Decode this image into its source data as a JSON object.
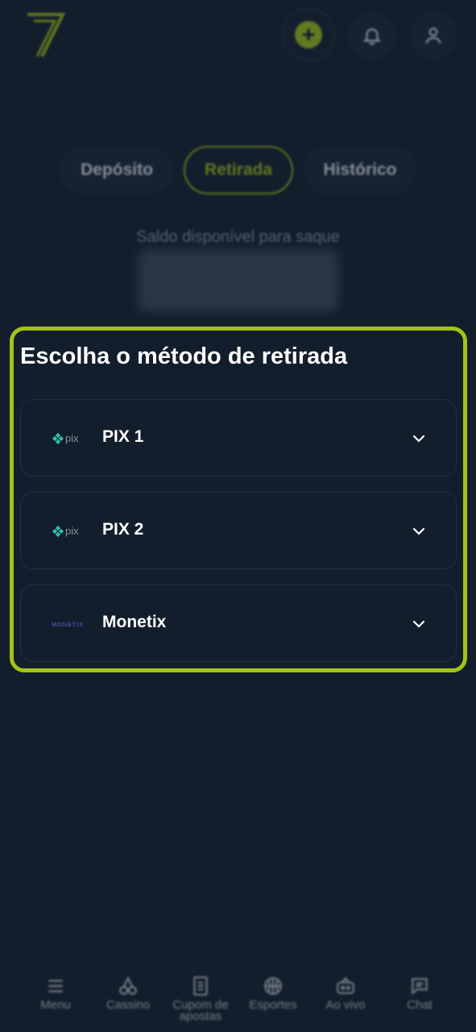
{
  "header": {
    "logo_icon": "seven-logo-icon",
    "deposit_icon": "plus-icon",
    "bell_icon": "bell-icon",
    "user_icon": "user-icon"
  },
  "tabs": [
    {
      "label": "Depósito",
      "active": false
    },
    {
      "label": "Retirada",
      "active": true
    },
    {
      "label": "Histórico",
      "active": false
    }
  ],
  "balance": {
    "label": "Saldo disponível para saque"
  },
  "withdraw": {
    "title": "Escolha o método de retirada",
    "methods": [
      {
        "label": "PIX 1",
        "logo_text": "pix"
      },
      {
        "label": "PIX 2",
        "logo_text": "pix"
      },
      {
        "label": "Monetix",
        "logo_text": "MONETIX"
      }
    ]
  },
  "bottom_nav": [
    {
      "label": "Menu",
      "icon": "menu-icon"
    },
    {
      "label": "Cassino",
      "icon": "cherries-icon"
    },
    {
      "label": "Cupom de apostas",
      "icon": "ticket-icon"
    },
    {
      "label": "Esportes",
      "icon": "basketball-icon"
    },
    {
      "label": "Ao vivo",
      "icon": "live-icon"
    },
    {
      "label": "Chat",
      "icon": "chat-icon"
    }
  ],
  "colors": {
    "background": "#131e2c",
    "accent": "#a3c21a",
    "pix": "#32bcad",
    "monetix": "#4a4aa8"
  }
}
